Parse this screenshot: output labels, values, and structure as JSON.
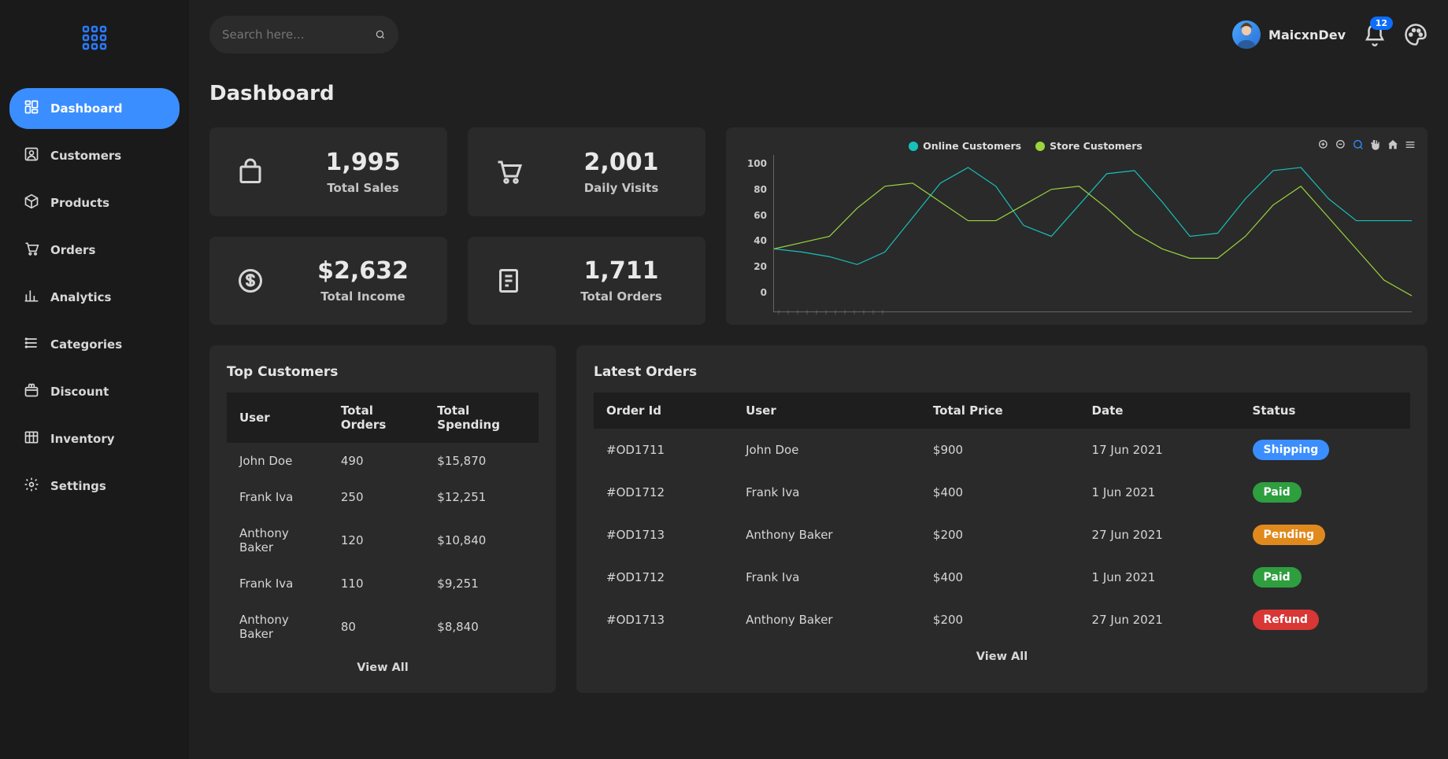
{
  "app": {
    "username": "MaicxnDev",
    "notif_count": "12",
    "search_placeholder": "Search here..."
  },
  "page_title": "Dashboard",
  "nav": [
    {
      "label": "Dashboard",
      "active": true
    },
    {
      "label": "Customers",
      "active": false
    },
    {
      "label": "Products",
      "active": false
    },
    {
      "label": "Orders",
      "active": false
    },
    {
      "label": "Analytics",
      "active": false
    },
    {
      "label": "Categories",
      "active": false
    },
    {
      "label": "Discount",
      "active": false
    },
    {
      "label": "Inventory",
      "active": false
    },
    {
      "label": "Settings",
      "active": false
    }
  ],
  "stats": [
    {
      "icon": "bag-icon",
      "value": "1,995",
      "label": "Total Sales"
    },
    {
      "icon": "cart-icon",
      "value": "2,001",
      "label": "Daily Visits"
    },
    {
      "icon": "dollar-icon",
      "value": "$2,632",
      "label": "Total Income"
    },
    {
      "icon": "receipt-icon",
      "value": "1,711",
      "label": "Total Orders"
    }
  ],
  "chart_data": {
    "type": "line",
    "ylim": [
      0,
      100
    ],
    "yticks": [
      0,
      20,
      40,
      60,
      80,
      100
    ],
    "series": [
      {
        "name": "Online Customers",
        "color": "#17c1ba",
        "values": [
          40,
          38,
          35,
          30,
          38,
          60,
          82,
          92,
          80,
          55,
          48,
          68,
          88,
          90,
          70,
          48,
          50,
          72,
          90,
          92,
          72,
          58,
          58,
          58
        ]
      },
      {
        "name": "Store Customers",
        "color": "#9bd43e",
        "values": [
          40,
          44,
          48,
          66,
          80,
          82,
          70,
          58,
          58,
          68,
          78,
          80,
          66,
          50,
          40,
          34,
          34,
          48,
          68,
          80,
          60,
          40,
          20,
          10
        ]
      }
    ]
  },
  "top_customers": {
    "title": "Top Customers",
    "columns": [
      "User",
      "Total Orders",
      "Total Spending"
    ],
    "rows": [
      [
        "John Doe",
        "490",
        "$15,870"
      ],
      [
        "Frank Iva",
        "250",
        "$12,251"
      ],
      [
        "Anthony Baker",
        "120",
        "$10,840"
      ],
      [
        "Frank Iva",
        "110",
        "$9,251"
      ],
      [
        "Anthony Baker",
        "80",
        "$8,840"
      ]
    ],
    "view_all": "View All"
  },
  "latest_orders": {
    "title": "Latest Orders",
    "columns": [
      "Order Id",
      "User",
      "Total Price",
      "Date",
      "Status"
    ],
    "rows": [
      {
        "id": "#OD1711",
        "user": "John Doe",
        "price": "$900",
        "date": "17 Jun 2021",
        "status": "Shipping",
        "status_class": "shipping"
      },
      {
        "id": "#OD1712",
        "user": "Frank Iva",
        "price": "$400",
        "date": "1 Jun 2021",
        "status": "Paid",
        "status_class": "paid"
      },
      {
        "id": "#OD1713",
        "user": "Anthony Baker",
        "price": "$200",
        "date": "27 Jun 2021",
        "status": "Pending",
        "status_class": "pending"
      },
      {
        "id": "#OD1712",
        "user": "Frank Iva",
        "price": "$400",
        "date": "1 Jun 2021",
        "status": "Paid",
        "status_class": "paid"
      },
      {
        "id": "#OD1713",
        "user": "Anthony Baker",
        "price": "$200",
        "date": "27 Jun 2021",
        "status": "Refund",
        "status_class": "refund"
      }
    ],
    "view_all": "View All"
  }
}
